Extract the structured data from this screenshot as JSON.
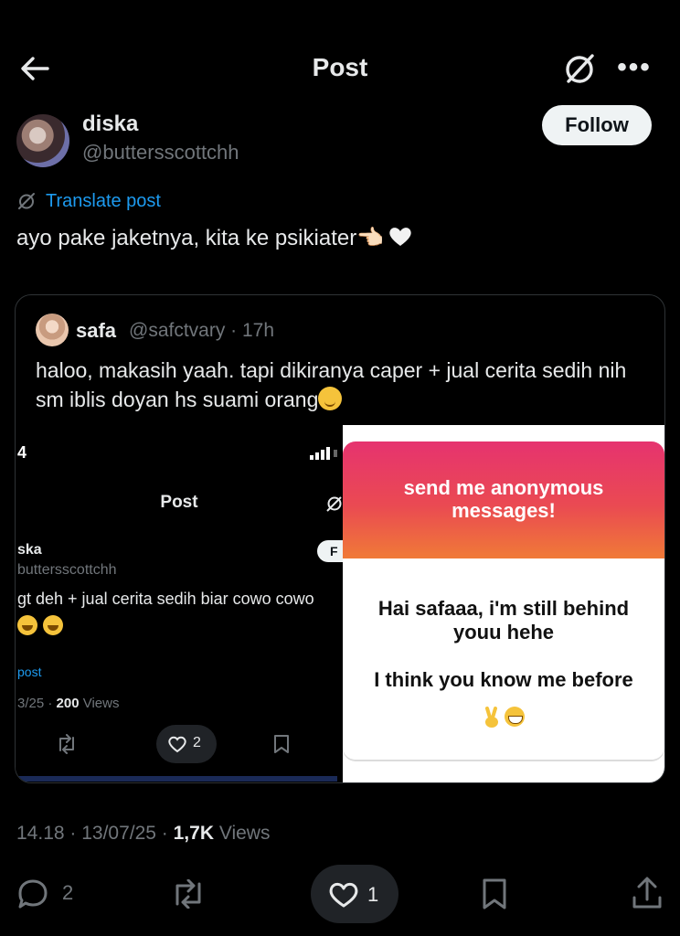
{
  "header": {
    "title": "Post",
    "back_icon": "arrow-left-icon",
    "grok_icon": "grok-icon",
    "more_label": "•••"
  },
  "author": {
    "name": "diska",
    "handle": "@buttersscottchh",
    "follow_label": "Follow"
  },
  "translate_label": "Translate post",
  "post_text": "ayo pake jaketnya, kita ke psikiater👈🏻",
  "quote": {
    "name": "safa",
    "handle_time": "@safctvary · 17h",
    "text": "haloo, makasih yaah. tapi dikiranya caper + jual cerita sedih nih sm iblis doyan hs suami orang",
    "left_screenshot": {
      "time": "4",
      "title": "Post",
      "name": "ska",
      "handle": "buttersscottchh",
      "follow_label": "F",
      "text": "gt deh + jual cerita sedih biar cowo cowo",
      "translate": "post",
      "date": "3/25 · ",
      "views_count": "200",
      "views_label": " Views",
      "like_count": "2"
    },
    "right_screenshot": {
      "prompt": "send me anonymous messages!",
      "message": "Hai safaaa, i'm still behind youu hehe\n\nI think you know me before"
    }
  },
  "meta": {
    "timestamp": "14.18 · 13/07/25 · ",
    "views_count": "1,7K",
    "views_label": " Views"
  },
  "actions": {
    "reply_count": "2",
    "like_count": "1"
  },
  "colors": {
    "background": "#000000",
    "link": "#1d9bf0",
    "secondary_text": "#71767b",
    "gradient_top": "#e6336f",
    "gradient_bottom": "#f07a37"
  }
}
